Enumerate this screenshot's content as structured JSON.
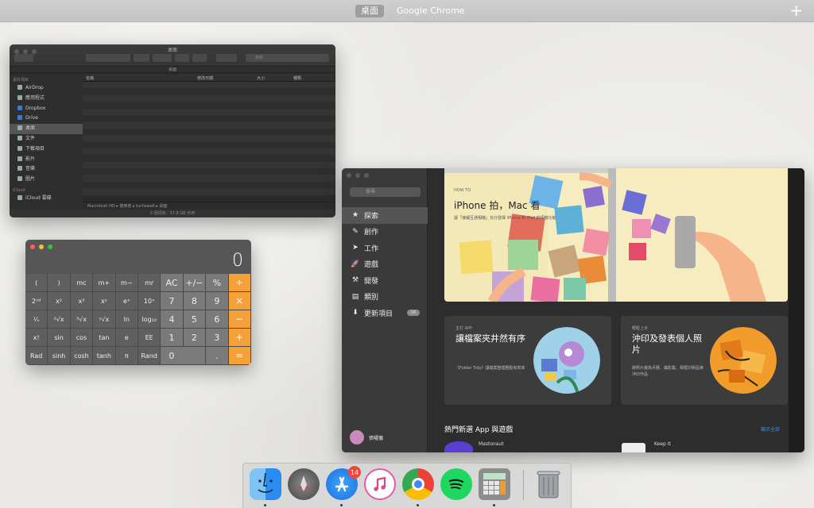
{
  "spaces": {
    "active": "桌面",
    "other": "Google Chrome",
    "add": "+"
  },
  "finder": {
    "title": "桌面",
    "path_title": "桌面",
    "search_placeholder": "搜尋",
    "sidebar_head_fav": "喜好項目",
    "sidebar_head_icloud": "iCloud",
    "items": [
      "AirDrop",
      "應用程式",
      "Dropbox",
      "Drive",
      "桌面",
      "文件",
      "下載項目",
      "影片",
      "音樂",
      "圖片"
    ],
    "icloud_item": "iCloud 雲碟",
    "columns": {
      "name": "名稱",
      "date": "修改日期",
      "size": "大小",
      "kind": "種類"
    },
    "crumbs": "Macintosh HD ▸ 使用者 ▸ turtlewall ▸ 桌面",
    "status": "0 個項目，57.8 GB 可用"
  },
  "calculator": {
    "display": "0",
    "keys": [
      [
        "(",
        ")",
        "mc",
        "m+",
        "m−",
        "mr",
        "AC",
        "+/−",
        "%",
        "÷"
      ],
      [
        "2ⁿᵈ",
        "x²",
        "x³",
        "xʸ",
        "eˣ",
        "10ˣ",
        "7",
        "8",
        "9",
        "×"
      ],
      [
        "¹⁄ₓ",
        "²√x",
        "³√x",
        "ʸ√x",
        "ln",
        "log₁₀",
        "4",
        "5",
        "6",
        "−"
      ],
      [
        "x!",
        "sin",
        "cos",
        "tan",
        "e",
        "EE",
        "1",
        "2",
        "3",
        "+"
      ],
      [
        "Rad",
        "sinh",
        "cosh",
        "tanh",
        "π",
        "Rand",
        "0",
        ".",
        "="
      ]
    ]
  },
  "appstore": {
    "search_placeholder": "搜尋",
    "nav": [
      {
        "label": "探索",
        "icon": "★"
      },
      {
        "label": "創作",
        "icon": "✎"
      },
      {
        "label": "工作",
        "icon": "➤"
      },
      {
        "label": "遊戲",
        "icon": "🚀"
      },
      {
        "label": "開發",
        "icon": "⚒"
      },
      {
        "label": "類別",
        "icon": "▤"
      },
      {
        "label": "更新項目",
        "icon": "⬇"
      }
    ],
    "updates_badge": "14",
    "user": "張曜儀",
    "hero": {
      "kicker": "HOW TO",
      "title": "iPhone 拍，Mac 看",
      "subtitle": "讓「接續互通相機」充分發揮 iPhone 和 iPad 的相機功能"
    },
    "card1": {
      "category": "主打 APP",
      "title": "讓檔案夾井然有序",
      "desc": "《Folder Tidy》讓檔案整理輕鬆有效率"
    },
    "card2": {
      "category": "輕鬆上手",
      "title": "沖印及發表個人照片",
      "desc": "將照片變為月曆、攝影集、相框印刷品等沖印作品"
    },
    "section_title": "熱門新選 App 與遊戲",
    "section_link": "顯示全部",
    "apps": [
      "Mastonaut",
      "Keep It"
    ]
  },
  "dock": {
    "apps": [
      "Finder",
      "Launchpad",
      "App Store",
      "iTunes",
      "Google Chrome",
      "Spotify",
      "Calculator"
    ],
    "appstore_badge": "14",
    "trash": "Trash"
  }
}
